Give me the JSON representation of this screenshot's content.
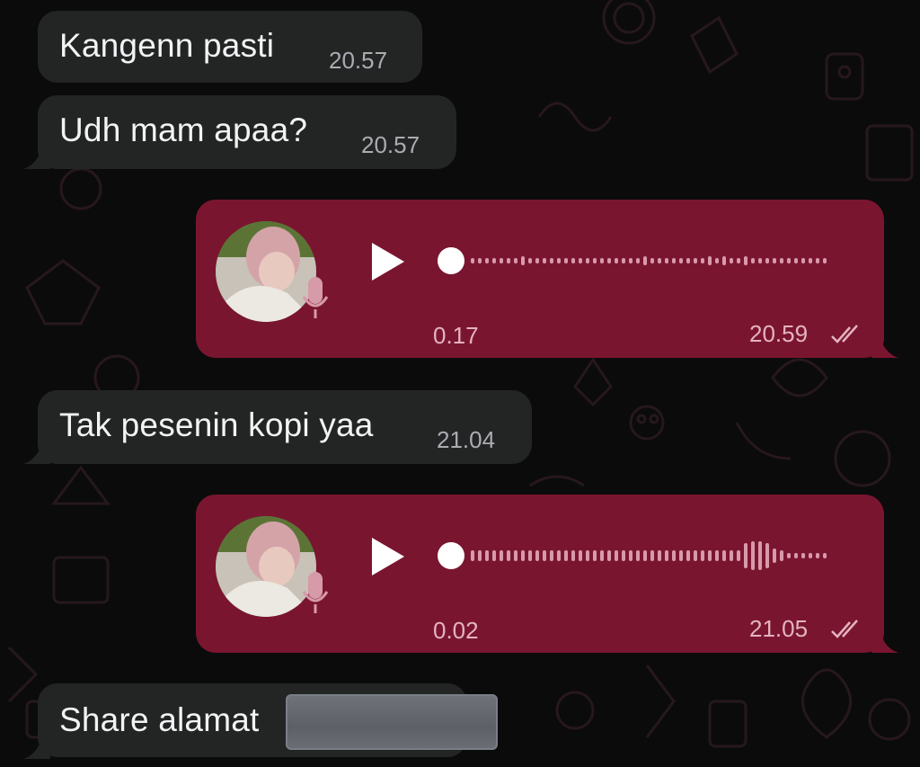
{
  "chat": {
    "messages": [
      {
        "type": "incoming",
        "text": "Kangenn pasti",
        "time": "20.57"
      },
      {
        "type": "incoming",
        "text": "Udh mam apaa?",
        "time": "20.57"
      },
      {
        "type": "voice",
        "duration": "0.17",
        "time": "20.59",
        "status_icon": "double-check-icon"
      },
      {
        "type": "incoming",
        "text": "Tak pesenin kopi yaa",
        "time": "21.04"
      },
      {
        "type": "voice",
        "duration": "0.02",
        "time": "21.05",
        "status_icon": "double-check-icon"
      },
      {
        "type": "incoming",
        "text": "Share alamat",
        "redacted": true
      }
    ]
  },
  "colors": {
    "background": "#0b0b0b",
    "incoming_bubble": "#232525",
    "outgoing_bubble": "#7a1530",
    "outgoing_meta": "#e4b3c0"
  }
}
